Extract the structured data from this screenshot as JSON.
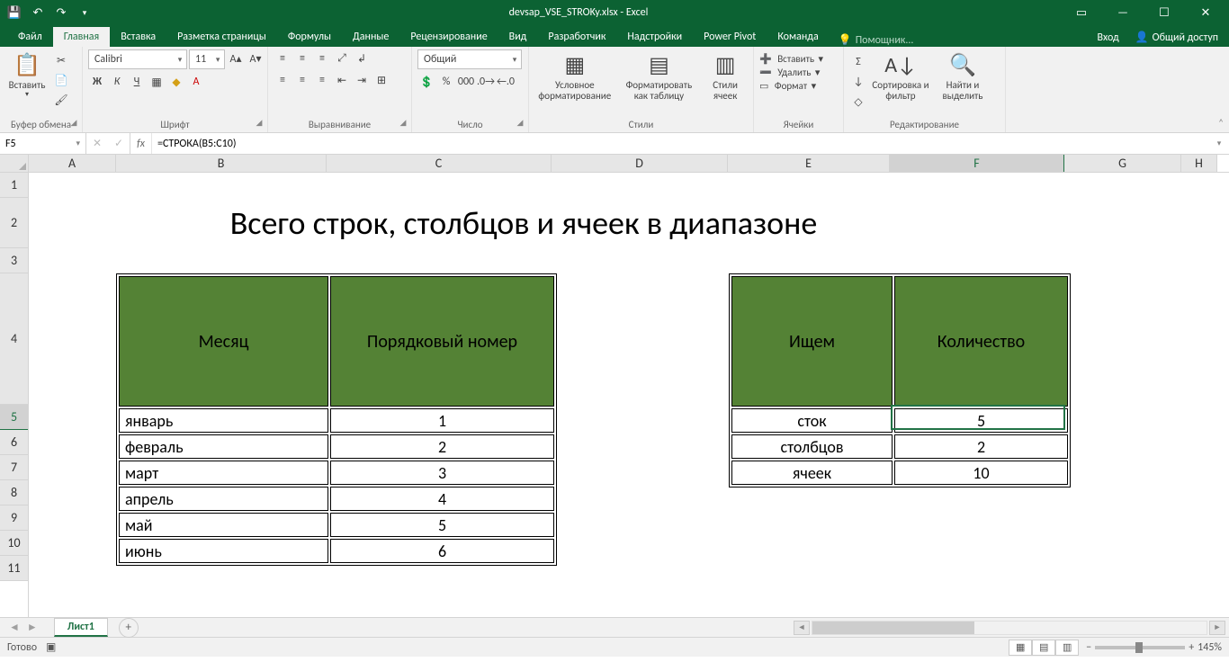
{
  "titlebar": {
    "filename": "devsap_VSE_STROKy.xlsx - Excel"
  },
  "tabs": {
    "file": "Файл",
    "items": [
      "Главная",
      "Вставка",
      "Разметка страницы",
      "Формулы",
      "Данные",
      "Рецензирование",
      "Вид",
      "Разработчик",
      "Надстройки",
      "Power Pivot",
      "Команда"
    ],
    "tell_me": "Помощник...",
    "signin": "Вход",
    "share": "Общий доступ"
  },
  "ribbon": {
    "clipboard": {
      "paste": "Вставить",
      "label": "Буфер обмена"
    },
    "font": {
      "name": "Calibri",
      "size": "11",
      "label": "Шрифт",
      "bold": "Ж",
      "italic": "К",
      "underline": "Ч"
    },
    "alignment": {
      "label": "Выравнивание"
    },
    "number": {
      "format": "Общий",
      "label": "Число"
    },
    "styles": {
      "label": "Стили",
      "cond": "Условное форматирование",
      "table": "Форматировать как таблицу",
      "cell": "Стили ячеек"
    },
    "cells": {
      "label": "Ячейки",
      "insert": "Вставить",
      "delete": "Удалить",
      "format": "Формат"
    },
    "editing": {
      "label": "Редактирование",
      "sort": "Сортировка и фильтр",
      "find": "Найти и выделить"
    }
  },
  "namebox": "F5",
  "formula": "=СТРОКА(B5:C10)",
  "columns": [
    "A",
    "B",
    "C",
    "D",
    "E",
    "F",
    "G",
    "H"
  ],
  "rows": [
    "1",
    "2",
    "3",
    "4",
    "5",
    "6",
    "7",
    "8",
    "9",
    "10",
    "11"
  ],
  "sheet": {
    "title": "Всего строк, столбцов и ячеек в диапазоне",
    "table1": {
      "headers": [
        "Месяц",
        "Порядковый номер"
      ],
      "rows": [
        [
          "январь",
          "1"
        ],
        [
          "февраль",
          "2"
        ],
        [
          "март",
          "3"
        ],
        [
          "апрель",
          "4"
        ],
        [
          "май",
          "5"
        ],
        [
          "июнь",
          "6"
        ]
      ]
    },
    "table2": {
      "headers": [
        "Ищем",
        "Количество"
      ],
      "rows": [
        [
          "сток",
          "5"
        ],
        [
          "столбцов",
          "2"
        ],
        [
          "ячеек",
          "10"
        ]
      ]
    }
  },
  "sheettab": "Лист1",
  "status": {
    "ready": "Готово",
    "zoom": "145%"
  }
}
